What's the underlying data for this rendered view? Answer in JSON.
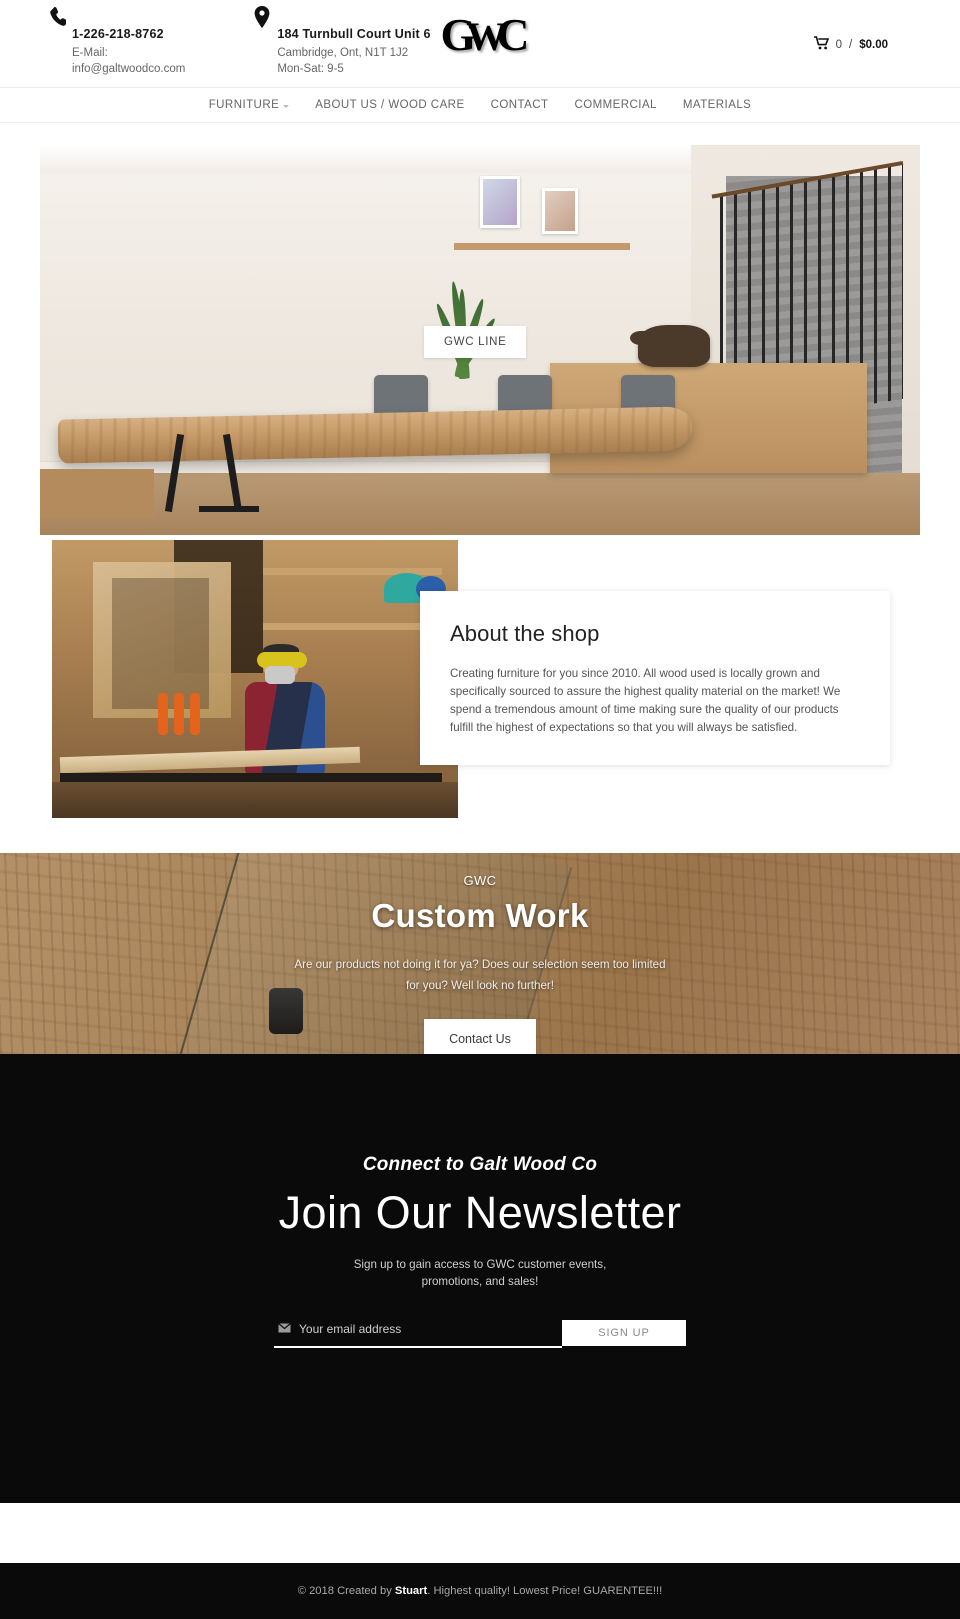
{
  "header": {
    "phone": {
      "icon": "phone-icon",
      "number": "1-226-218-8762",
      "email_label": "E-Mail:",
      "email": "info@galtwoodco.com"
    },
    "address": {
      "icon": "map-pin-icon",
      "street": "184 Turnbull Court Unit 6",
      "city": "Cambridge, Ont, N1T 1J2",
      "hours": "Mon-Sat: 9-5"
    },
    "logo": {
      "left": "G",
      "middle": "W",
      "right": "C",
      "full": "GWC"
    },
    "cart": {
      "icon": "shopping-cart-icon",
      "count": "0",
      "separator": "/",
      "total": "$0.00"
    }
  },
  "nav": {
    "items": [
      {
        "label": "FURNITURE",
        "has_dropdown": true
      },
      {
        "label": "ABOUT US / WOOD CARE",
        "has_dropdown": false
      },
      {
        "label": "CONTACT",
        "has_dropdown": false
      },
      {
        "label": "COMMERCIAL",
        "has_dropdown": false
      },
      {
        "label": "MATERIALS",
        "has_dropdown": false
      }
    ]
  },
  "hero": {
    "label": "GWC LINE",
    "alt": "live-edge dining table in modern dining room"
  },
  "about": {
    "image_alt": "woodworker sanding a plank in the workshop",
    "title": "About the shop",
    "body": "Creating furniture for you since 2010. All wood used is locally grown and specifically sourced to assure the highest quality material on the market! We spend a tremendous amount of time making sure the quality of our products fulfill the highest of expectations so that you will always be satisfied."
  },
  "custom_work": {
    "eyebrow": "GWC",
    "title": "Custom Work",
    "subtitle": "Are our products not doing it for ya? Does our selection seem too limited for you? Well look no further!",
    "button": "Contact Us"
  },
  "newsletter": {
    "eyebrow": "Connect to Galt Wood Co",
    "title": "Join Our Newsletter",
    "subtitle_line1": "Sign up to gain access to GWC customer events,",
    "subtitle_line2": "promotions, and sales!",
    "email_icon": "envelope-icon",
    "email_placeholder": "Your email address",
    "email_value": "",
    "button": "SIGN UP"
  },
  "footer": {
    "prefix": "© 2018 Created by ",
    "author": "Stuart",
    "suffix": ". Highest quality! Lowest Price! GUARENTEE!!!"
  },
  "colors": {
    "page_bg": "#ffffff",
    "dark_section": "#0a0a0a",
    "nav_text": "#666666",
    "accent_white": "#ffffff"
  }
}
